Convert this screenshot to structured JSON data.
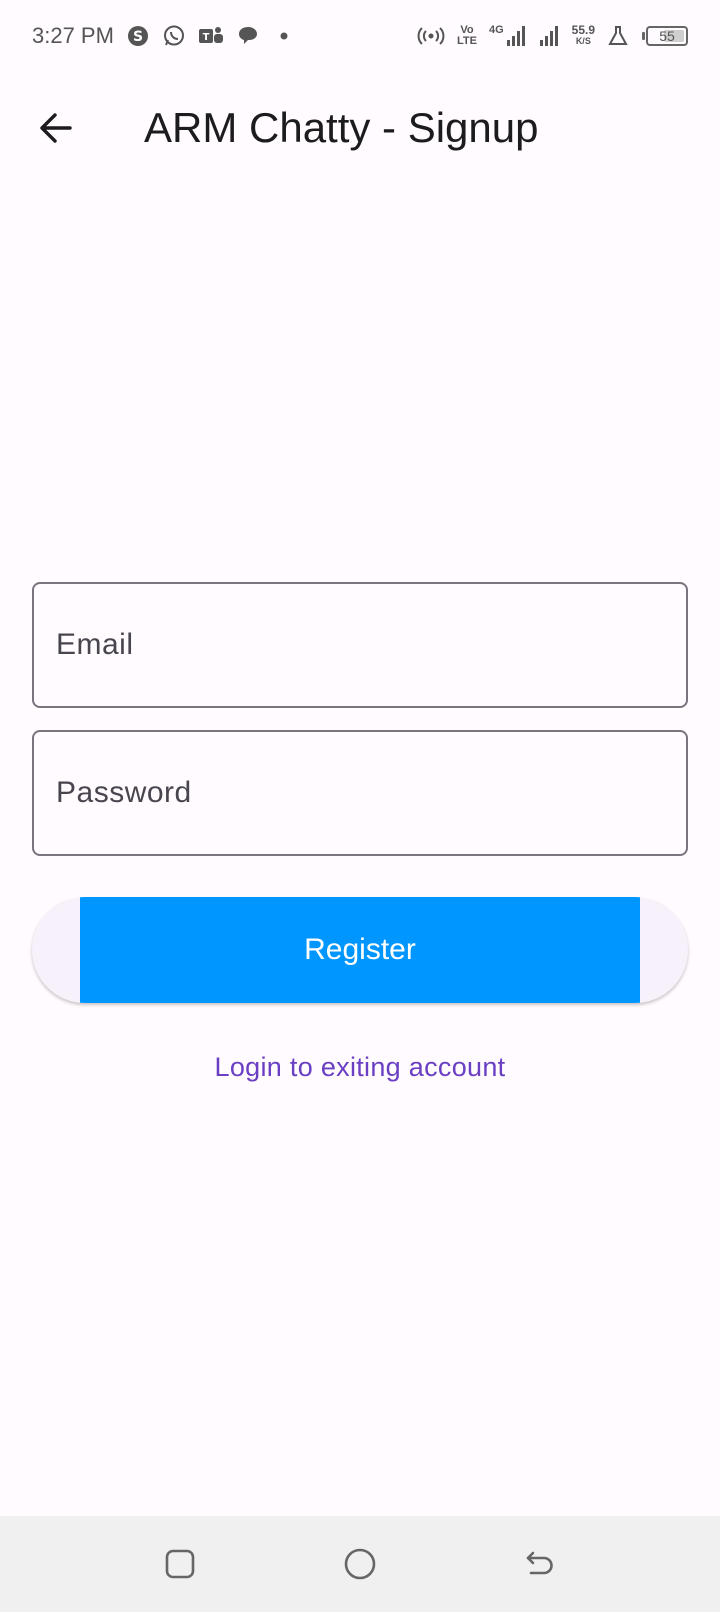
{
  "status_bar": {
    "time": "3:27 PM",
    "volte_top": "Vo",
    "volte_bottom": "LTE",
    "network_type": "4G",
    "net_speed_value": "55.9",
    "net_speed_unit": "K/S",
    "battery_level": "55",
    "icons": [
      "skype-icon",
      "whatsapp-icon",
      "teams-icon",
      "chat-bubble-icon",
      "dot-icon",
      "hotspot-icon",
      "signal-icon",
      "lab-flask-icon",
      "battery-icon"
    ]
  },
  "app_bar": {
    "title": "ARM Chatty - Signup",
    "back_icon": "arrow-left-icon"
  },
  "form": {
    "email_placeholder": "Email",
    "email_value": "",
    "password_placeholder": "Password",
    "password_value": "",
    "register_label": "Register",
    "login_link": "Login to exiting account"
  },
  "colors": {
    "primary_button": "#0096ff",
    "link": "#6a3fc4",
    "background": "#fffbfe",
    "field_border": "#79747e"
  },
  "nav_bar": {
    "icons": [
      "recent-apps-icon",
      "home-icon",
      "back-icon"
    ]
  }
}
